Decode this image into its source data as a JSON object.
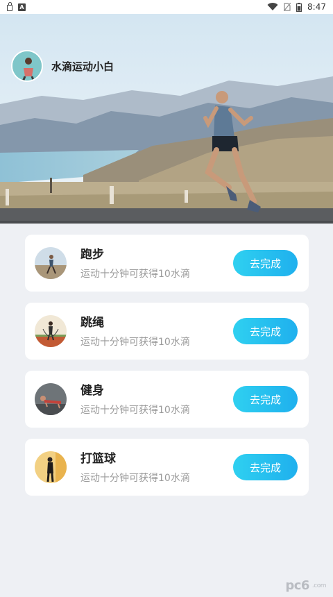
{
  "status_bar": {
    "time": "8:47",
    "icons": [
      "lock-icon",
      "a-icon",
      "wifi-icon",
      "no-sim-icon",
      "battery-icon"
    ]
  },
  "profile": {
    "username": "水滴运动小白"
  },
  "tasks": [
    {
      "title": "跑步",
      "desc": "运动十分钟可获得10水滴",
      "button": "去完成",
      "icon": "running-thumbnail"
    },
    {
      "title": "跳绳",
      "desc": "运动十分钟可获得10水滴",
      "button": "去完成",
      "icon": "jump-rope-thumbnail"
    },
    {
      "title": "健身",
      "desc": "运动十分钟可获得10水滴",
      "button": "去完成",
      "icon": "fitness-thumbnail"
    },
    {
      "title": "打篮球",
      "desc": "运动十分钟可获得10水滴",
      "button": "去完成",
      "icon": "basketball-thumbnail"
    }
  ],
  "watermark": {
    "brand": "pc6",
    "sub": ".com"
  },
  "colors": {
    "accent_start": "#2fd0f0",
    "accent_end": "#1fb0ee",
    "background": "#eef0f4"
  }
}
